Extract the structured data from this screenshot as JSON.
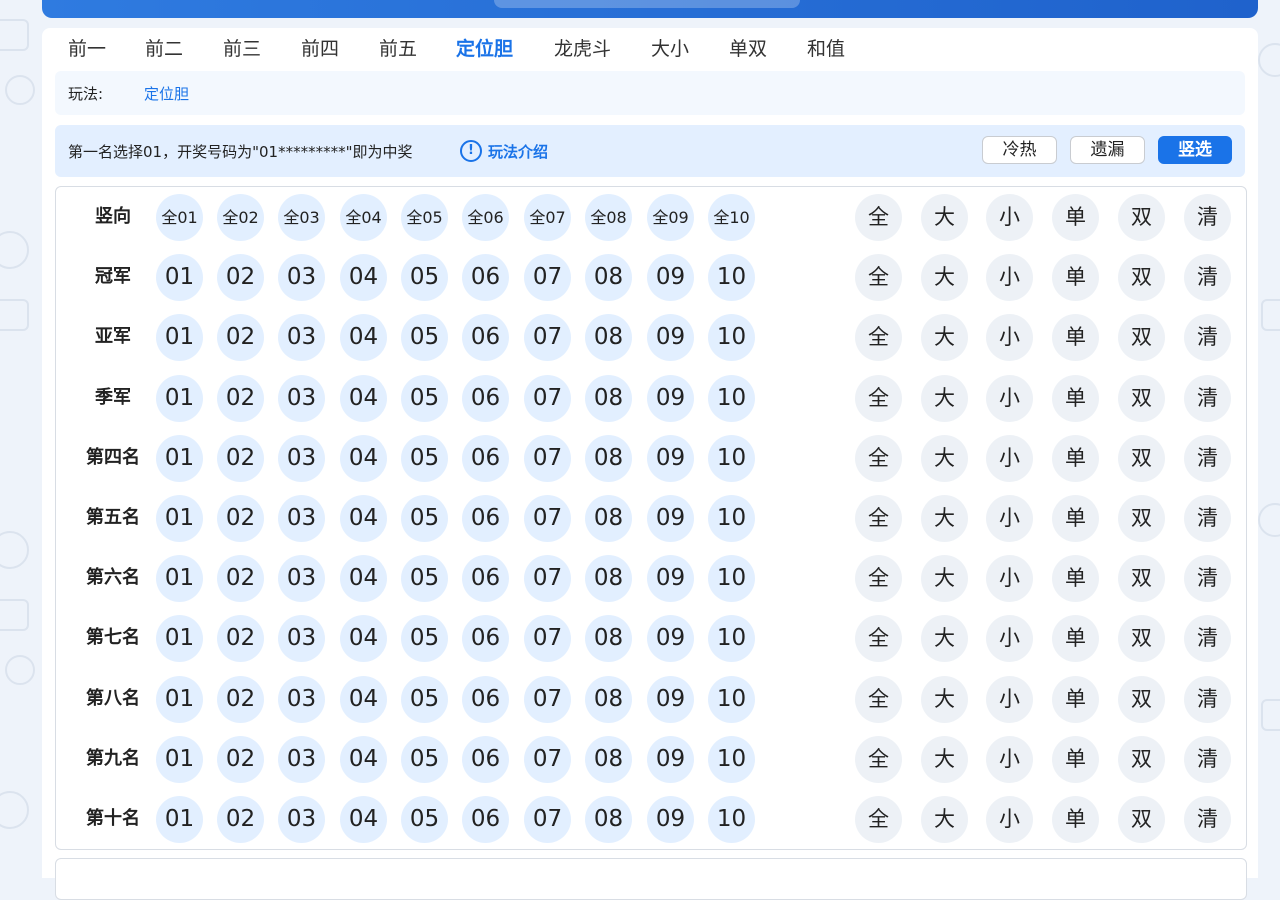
{
  "tabs": [
    "前一",
    "前二",
    "前三",
    "前四",
    "前五",
    "定位胆",
    "龙虎斗",
    "大小",
    "单双",
    "和值"
  ],
  "active_tab": "定位胆",
  "play": {
    "label": "玩法:",
    "value": "定位胆"
  },
  "info": {
    "text": "第一名选择01，开奖号码为\"01*********\"即为中奖",
    "icon_name": "info-circle-icon",
    "link": "玩法介绍"
  },
  "mode_buttons": [
    "冷热",
    "遗漏",
    "竖选"
  ],
  "active_mode": "竖选",
  "grid": {
    "header": {
      "label": "竖向",
      "balls": [
        "全01",
        "全02",
        "全03",
        "全04",
        "全05",
        "全06",
        "全07",
        "全08",
        "全09",
        "全10"
      ]
    },
    "rows": [
      {
        "label": "冠军"
      },
      {
        "label": "亚军"
      },
      {
        "label": "季军"
      },
      {
        "label": "第四名"
      },
      {
        "label": "第五名"
      },
      {
        "label": "第六名"
      },
      {
        "label": "第七名"
      },
      {
        "label": "第八名"
      },
      {
        "label": "第九名"
      },
      {
        "label": "第十名"
      }
    ],
    "numbers": [
      "01",
      "02",
      "03",
      "04",
      "05",
      "06",
      "07",
      "08",
      "09",
      "10"
    ],
    "controls": [
      "全",
      "大",
      "小",
      "单",
      "双",
      "清"
    ]
  },
  "colors": {
    "accent": "#1a73e8",
    "ball_bg": "#e2efff",
    "ctrl_bg": "#edf1f6",
    "info_bg": "#e3efff"
  }
}
